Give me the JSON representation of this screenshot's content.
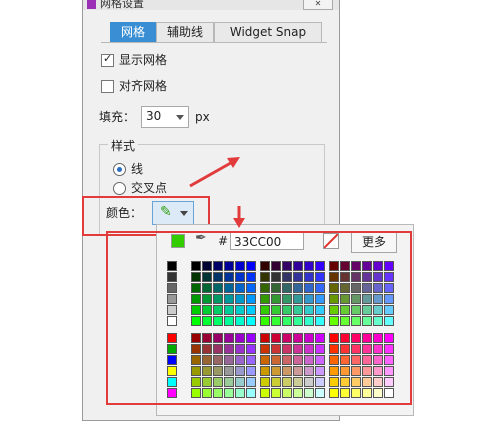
{
  "dialog": {
    "title": "网格设置",
    "close_label": "✕",
    "tabs": [
      {
        "label": "网格",
        "active": true
      },
      {
        "label": "辅助线",
        "active": false
      },
      {
        "label": "Widget Snap",
        "active": false
      }
    ],
    "show_grid": {
      "label": "显示网格",
      "checked": true
    },
    "snap_grid": {
      "label": "对齐网格",
      "checked": false
    },
    "fill": {
      "label": "填充：",
      "value": "30",
      "unit": "px"
    },
    "style_group": {
      "title": "样式",
      "options": [
        {
          "label": "线",
          "selected": true
        },
        {
          "label": "交叉点",
          "selected": false
        }
      ],
      "color_label": "颜色："
    }
  },
  "color_picker": {
    "current_color": "#33CC00",
    "hash": "#",
    "hex_value": "33CC00",
    "more_label": "更多"
  },
  "accent": "#3a8fd4",
  "annotation_color": "#e23b3b"
}
